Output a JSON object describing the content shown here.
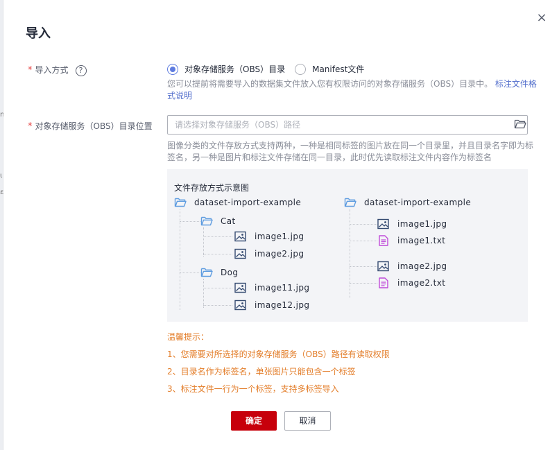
{
  "dialog": {
    "title": "导入",
    "close_symbol": "×"
  },
  "form": {
    "import_method": {
      "label": "导入方式",
      "required_mark": "*",
      "help_symbol": "?",
      "options": [
        {
          "label": "对象存储服务（OBS）目录",
          "checked": true
        },
        {
          "label": "Manifest文件",
          "checked": false
        }
      ],
      "hint_text": "您可以提前将需要导入的数据集文件放入您有权限访问的对象存储服务（OBS）目录中。",
      "hint_link": "标注文件格式说明"
    },
    "obs_path": {
      "label": "对象存储服务（OBS）目录位置",
      "required_mark": "*",
      "value": "",
      "placeholder": "请选择对象存储服务（OBS）路径",
      "browse_icon": "folder-open-icon",
      "description": "图像分类的文件存放方式支持两种，一种是相同标签的图片放在同一个目录里，并且目录名字即为标签名，另一种是图片和标注文件存储在同一目录，此时优先读取标注文件内容作为标签名"
    }
  },
  "diagram": {
    "title": "文件存放方式示意图",
    "left_tree": {
      "root": "dataset-import-example",
      "folders": [
        {
          "name": "Cat",
          "files": [
            "image1.jpg",
            "image2.jpg"
          ]
        },
        {
          "name": "Dog",
          "files": [
            "image11.jpg",
            "image12.jpg"
          ]
        }
      ]
    },
    "right_tree": {
      "root": "dataset-import-example",
      "files": [
        "image1.jpg",
        "image1.txt",
        "image2.jpg",
        "image2.txt"
      ]
    }
  },
  "tips": {
    "title": "温馨提示：",
    "items": [
      "1、您需要对所选择的对象存储服务（OBS）路径有读取权限",
      "2、目录名作为标签名，单张图片只能包含一个标签",
      "3、标注文件一行为一个标签，支持多标签导入"
    ]
  },
  "buttons": {
    "confirm": "确定",
    "cancel": "取消"
  },
  "colors": {
    "primary_button": "#c7000b",
    "radio_accent": "#5e7ce0",
    "link": "#526ecc",
    "tip_text": "#e37d29",
    "required": "#e54545",
    "folder_icon": "#5e9ce0",
    "image_icon": "#344a70",
    "text_icon": "#c04bd9"
  }
}
